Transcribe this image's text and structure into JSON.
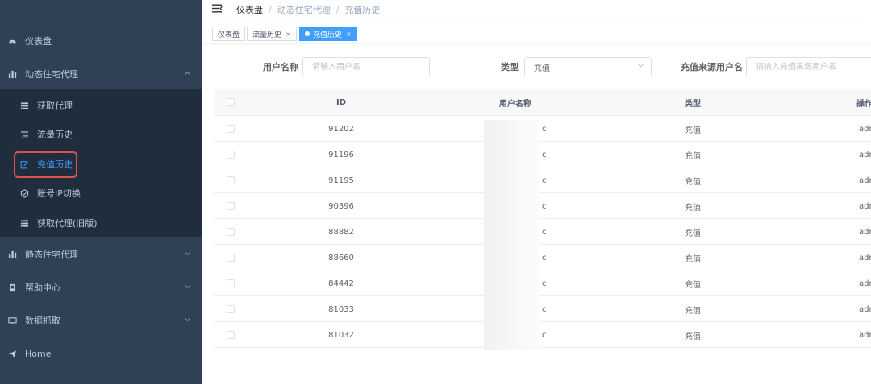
{
  "sidebar": {
    "dashboard": "仪表盘",
    "dynamic_proxy": "动态住宅代理",
    "sub": {
      "get_proxy": "获取代理",
      "traffic_history": "流量历史",
      "recharge_history": "充值历史",
      "account_ip_switch": "账号IP切换",
      "get_proxy_old": "获取代理(旧版)"
    },
    "static_proxy": "静态住宅代理",
    "help_center": "帮助中心",
    "data_scraping": "数据抓取",
    "home": "Home"
  },
  "breadcrumb": [
    "仪表盘",
    "动态住宅代理",
    "充值历史"
  ],
  "tags": [
    "仪表盘",
    "流量历史",
    "充值历史"
  ],
  "tag_close": "×",
  "filters": {
    "username_label": "用户名称",
    "username_placeholder": "请输入用户名",
    "type_label": "类型",
    "type_value": "充值",
    "source_label": "充值来源用户名",
    "source_placeholder": "请输入充值来源用户名"
  },
  "table": {
    "headers": {
      "id": "ID",
      "username": "用户名称",
      "type": "类型",
      "op": "操作"
    },
    "rows": [
      {
        "id": "91202",
        "user": "c",
        "type": "充值",
        "op": "adm"
      },
      {
        "id": "91196",
        "user": "c",
        "type": "充值",
        "op": "adm"
      },
      {
        "id": "91195",
        "user": "c",
        "type": "充值",
        "op": "adm"
      },
      {
        "id": "90396",
        "user": "c",
        "type": "充值",
        "op": "adm"
      },
      {
        "id": "88882",
        "user": "c",
        "type": "充值",
        "op": "adm"
      },
      {
        "id": "88660",
        "user": "c",
        "type": "充值",
        "op": "adm"
      },
      {
        "id": "84442",
        "user": "c",
        "type": "充值",
        "op": "adm"
      },
      {
        "id": "81033",
        "user": "c",
        "type": "充值",
        "op": "adm"
      },
      {
        "id": "81032",
        "user": "c",
        "type": "充值",
        "op": "adm"
      }
    ]
  },
  "colors": {
    "sidebar_bg": "#304156",
    "submenu_bg": "#1f2d3d",
    "accent": "#409eff",
    "highlight": "#d9534f"
  }
}
